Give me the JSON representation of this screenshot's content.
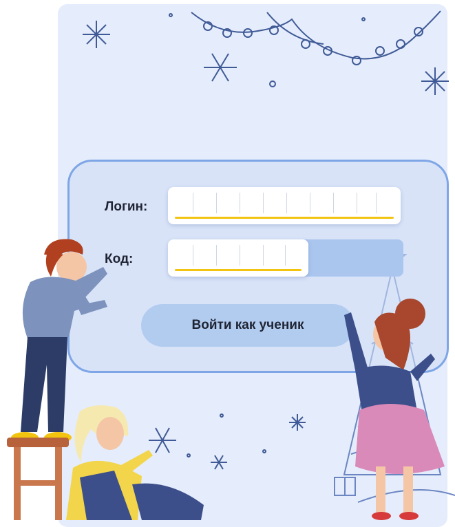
{
  "form": {
    "login_label": "Логин:",
    "code_label": "Код:",
    "login_value": "",
    "code_value": "",
    "login_cells": 10,
    "code_cells": 6,
    "submit_label": "Войти как ученик"
  },
  "colors": {
    "card_bg": "#e5ecfb",
    "frame_border": "#7ea6e6",
    "field_underline": "#f2c40f",
    "button_bg": "#b2ccf0",
    "text": "#1f2433"
  },
  "illustration": {
    "elements": [
      "snowflake-icon",
      "garland-icon",
      "christmas-tree-icon",
      "boy-on-stool",
      "girl-sitting",
      "girl-with-skirt",
      "gift-box-icon"
    ]
  }
}
